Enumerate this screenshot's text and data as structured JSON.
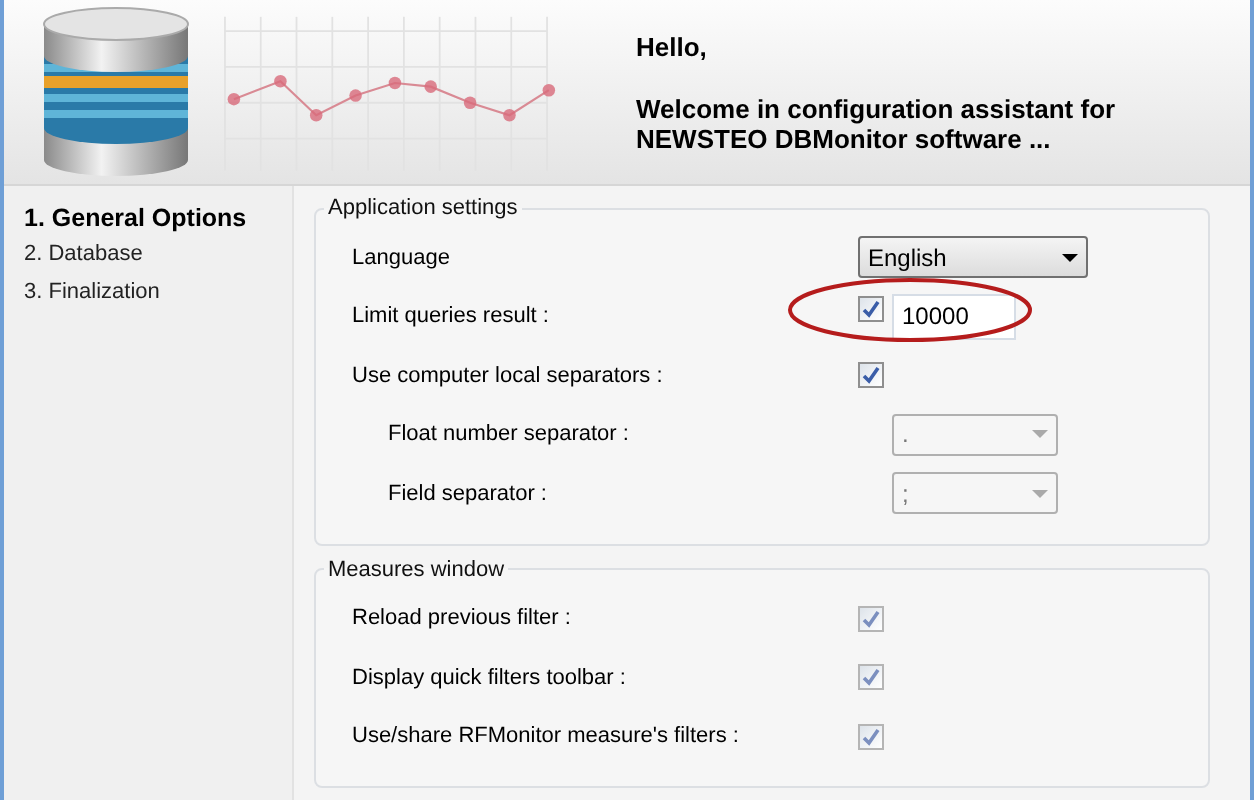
{
  "header": {
    "greeting": "Hello,",
    "welcome_lines": [
      "Welcome in configuration assistant for",
      "NEWSTEO DBMonitor software ..."
    ]
  },
  "steps": [
    {
      "label": "1.  General Options",
      "selected": true
    },
    {
      "label": "2.  Database",
      "selected": false
    },
    {
      "label": "3.  Finalization",
      "selected": false
    }
  ],
  "groups": [
    {
      "title": "Application settings",
      "rows": [
        {
          "kind": "dropdown",
          "label": "Language",
          "value": "English",
          "indented": false
        },
        {
          "kind": "checkbox_input",
          "label": "Limit queries result :",
          "checked": true,
          "value": "10000",
          "indented": false,
          "highlighted": true
        },
        {
          "kind": "checkbox",
          "label": "Use computer local separators :",
          "checked": true,
          "indented": false
        },
        {
          "kind": "disabled_dropdown",
          "label": "Float number separator :",
          "value": ".",
          "indented": true
        },
        {
          "kind": "disabled_dropdown",
          "label": "Field separator :",
          "value": ";",
          "indented": true
        }
      ]
    },
    {
      "title": "Measures window",
      "rows": [
        {
          "kind": "checkbox",
          "label": "Reload previous filter :",
          "checked": true,
          "disabled": true,
          "indented": false
        },
        {
          "kind": "checkbox",
          "label": "Display quick filters toolbar :",
          "checked": true,
          "disabled": true,
          "indented": false
        },
        {
          "kind": "checkbox",
          "label": "Use/share RFMonitor measure's filters :",
          "checked": true,
          "disabled": true,
          "indented": false
        }
      ]
    }
  ]
}
